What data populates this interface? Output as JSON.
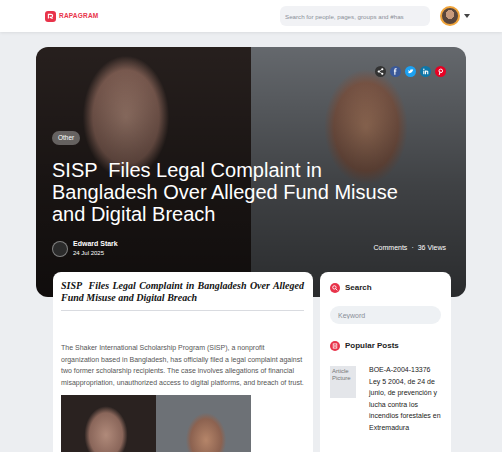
{
  "header": {
    "logo": "RAPAGRAM",
    "search": {
      "placeholder": "Search for people, pages, groups and #has"
    }
  },
  "hero": {
    "category": "Other",
    "title": "SISP  Files Legal Complaint in Bangladesh Over Alleged Fund Misuse and Digital Breach",
    "author": "Edward Stark",
    "date": "24 Jul 2025",
    "comments": "Comments",
    "separator": "·",
    "views": "36 Views"
  },
  "article": {
    "title": "SISP  Files Legal Complaint in Bangladesh Over Alleged Fund Misuse and Digital Breach",
    "paragraph": "The Shaker International Scholarship Program (SISP), a nonprofit organization based in Bangladesh, has officially filed a legal complaint against two former scholarship recipients. The case involves allegations of financial misappropriation, unauthorized access to digital platforms, and breach of trust."
  },
  "sidebar": {
    "search": {
      "title": "Search",
      "placeholder": "Keyword"
    },
    "popular": {
      "title": "Popular Posts",
      "posts": [
        {
          "image_alt": "Article Picture",
          "title": "BOE-A-2004-13376 Ley 5 2004, de 24 de junio, de prevención y lucha contra los incendios forestales en Extremadura"
        }
      ]
    }
  }
}
